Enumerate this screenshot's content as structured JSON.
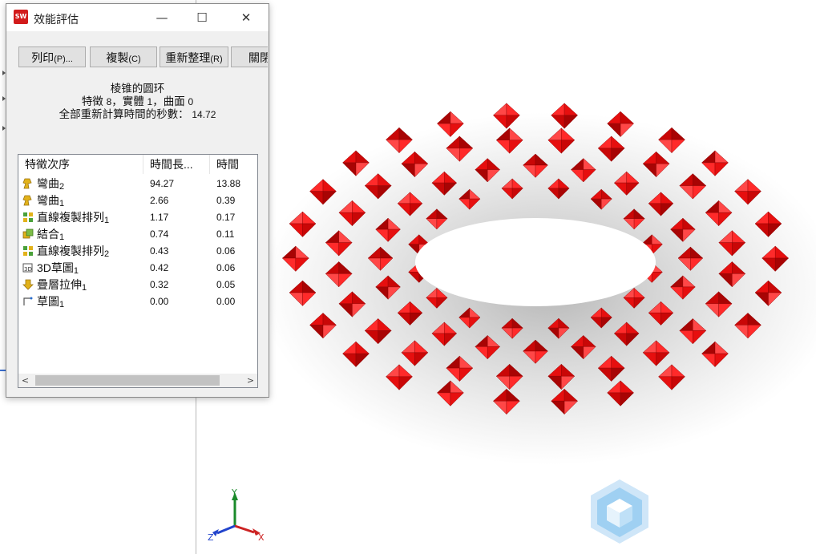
{
  "dialog": {
    "title": "效能評估",
    "app_icon_text": "SW",
    "window_buttons": {
      "minimize": "—",
      "maximize": "☐",
      "close": "✕"
    },
    "buttons": {
      "print_label": "列印",
      "print_accel": "(P)...",
      "copy_label": "複製",
      "copy_accel": "(C)",
      "refresh_label": "重新整理",
      "refresh_accel": "(R)",
      "close_label": "關閉"
    },
    "summary": {
      "part_name": "棱锥的圆环",
      "counts_prefix": "特徵 ",
      "feature_count": "8",
      "bodies_prefix": "，實體 ",
      "body_count": "1",
      "surfaces_prefix": "，曲面 ",
      "surface_count": "0",
      "rebuild_label": "全部重新計算時間的秒數：",
      "rebuild_time": "14.72"
    },
    "table": {
      "headers": [
        "特徵次序",
        "時間長...",
        "時間"
      ],
      "rows": [
        {
          "name": "彎曲",
          "sub": "2",
          "icon": "flex-feature-icon",
          "v1": "94.27",
          "v2": "13.88"
        },
        {
          "name": "彎曲",
          "sub": "1",
          "icon": "flex-feature-icon",
          "v1": "2.66",
          "v2": "0.39"
        },
        {
          "name": "直線複製排列",
          "sub": "1",
          "icon": "linear-pattern-icon",
          "v1": "1.17",
          "v2": "0.17"
        },
        {
          "name": "結合",
          "sub": "1",
          "icon": "combine-icon",
          "v1": "0.74",
          "v2": "0.11"
        },
        {
          "name": "直線複製排列",
          "sub": "2",
          "icon": "linear-pattern-icon",
          "v1": "0.43",
          "v2": "0.06"
        },
        {
          "name": "3D草圖",
          "sub": "1",
          "icon": "3d-sketch-icon",
          "v1": "0.42",
          "v2": "0.06"
        },
        {
          "name": "疊層拉伸",
          "sub": "1",
          "icon": "loft-icon",
          "v1": "0.32",
          "v2": "0.05"
        },
        {
          "name": "草圖",
          "sub": "1",
          "icon": "sketch-icon",
          "v1": "0.00",
          "v2": "0.00"
        }
      ]
    },
    "scroll": {
      "left_arrow": "<",
      "right_arrow": ">"
    }
  },
  "viewport": {
    "triad": {
      "x": "X",
      "y": "Y",
      "z": "Z"
    },
    "model_color": "#e00b0b"
  }
}
